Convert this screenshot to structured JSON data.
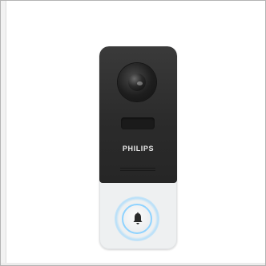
{
  "product": {
    "brand": "PHILIPS"
  },
  "colors": {
    "device_dark": "#2b2b2b",
    "device_light": "#eef0f1",
    "ring_light": "#8fd3ff"
  },
  "icons": {
    "camera": "camera-lens-icon",
    "bell": "bell-icon"
  }
}
